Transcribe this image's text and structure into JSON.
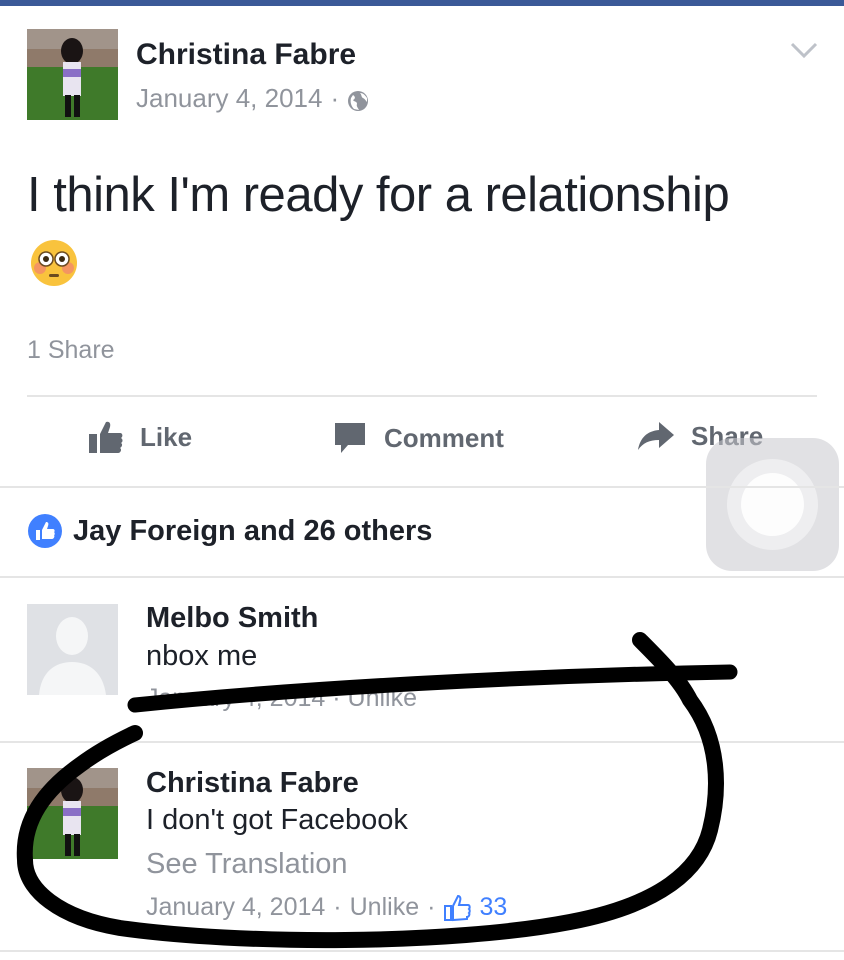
{
  "post": {
    "author": "Christina Fabre",
    "date": "January 4, 2014",
    "meta_separator": "·",
    "text": "I think I'm ready for a relationship",
    "emoji": "flushed-face",
    "share_count": "1 Share"
  },
  "actions": {
    "like": "Like",
    "comment": "Comment",
    "share": "Share"
  },
  "likes": {
    "summary": "Jay Foreign and 26 others"
  },
  "comments": [
    {
      "author": "Melbo Smith",
      "text": "nbox me",
      "meta": "January 4, 2014 · Unlike"
    },
    {
      "author": "Christina Fabre",
      "text": "I don't got Facebook",
      "translation_link": "See Translation",
      "date": "January 4, 2014",
      "separator": "·",
      "unlike": "Unlike",
      "like_count": "33"
    }
  ],
  "colors": {
    "brand": "#3b5998",
    "like_blue": "#4080ff",
    "text": "#1d2129",
    "secondary": "#90949c",
    "divider": "#e5e5e5"
  }
}
